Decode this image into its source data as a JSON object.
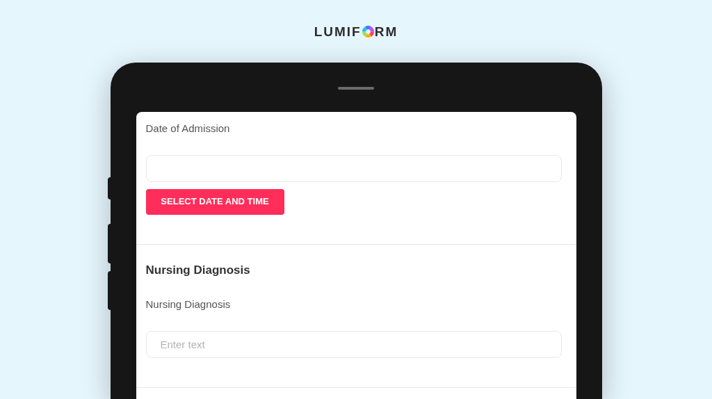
{
  "logo": {
    "before": "LUMIF",
    "after": "RM"
  },
  "form": {
    "sections": [
      {
        "label": "Date of Admission",
        "button": "SELECT DATE AND TIME"
      },
      {
        "heading": "Nursing Diagnosis",
        "label": "Nursing Diagnosis",
        "field": {
          "placeholder": "Enter text"
        }
      }
    ]
  }
}
